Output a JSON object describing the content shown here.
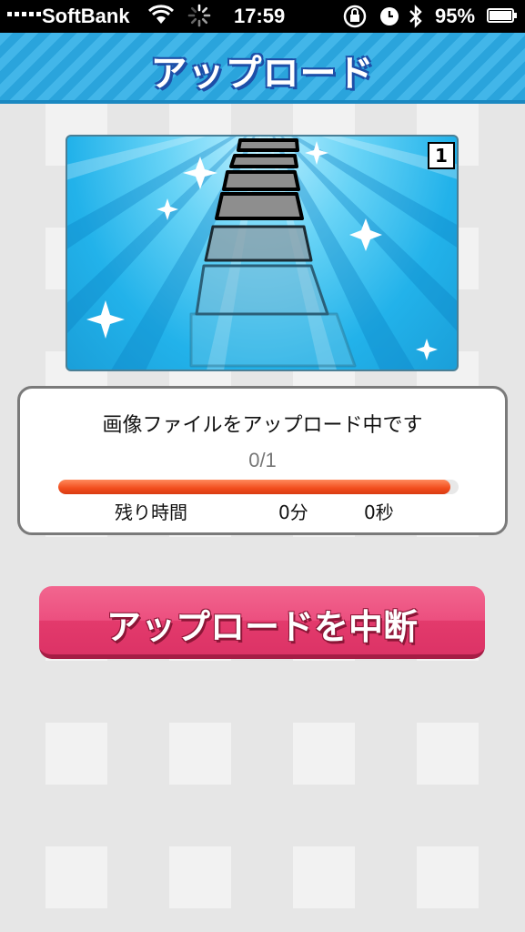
{
  "status_bar": {
    "carrier": "SoftBank",
    "time": "17:59",
    "battery": "95%",
    "icons": [
      "signal-icon",
      "wifi-icon",
      "activity-spinner-icon",
      "rotation-lock-icon",
      "alarm-icon",
      "bluetooth-icon",
      "battery-icon"
    ]
  },
  "header": {
    "title": "アップロード"
  },
  "preview": {
    "badge": "1"
  },
  "progress_card": {
    "status": "画像ファイルをアップロード中です",
    "progress_text": "0/1",
    "progress_fraction": 0.98,
    "time_label": "残り時間",
    "minutes": "0分",
    "seconds": "0秒"
  },
  "cancel_button": {
    "label": "アップロードを中断"
  },
  "colors": {
    "header_blue": "#2aa4dc",
    "progress_orange": "#f24d1d",
    "button_pink": "#ec4f7f"
  }
}
